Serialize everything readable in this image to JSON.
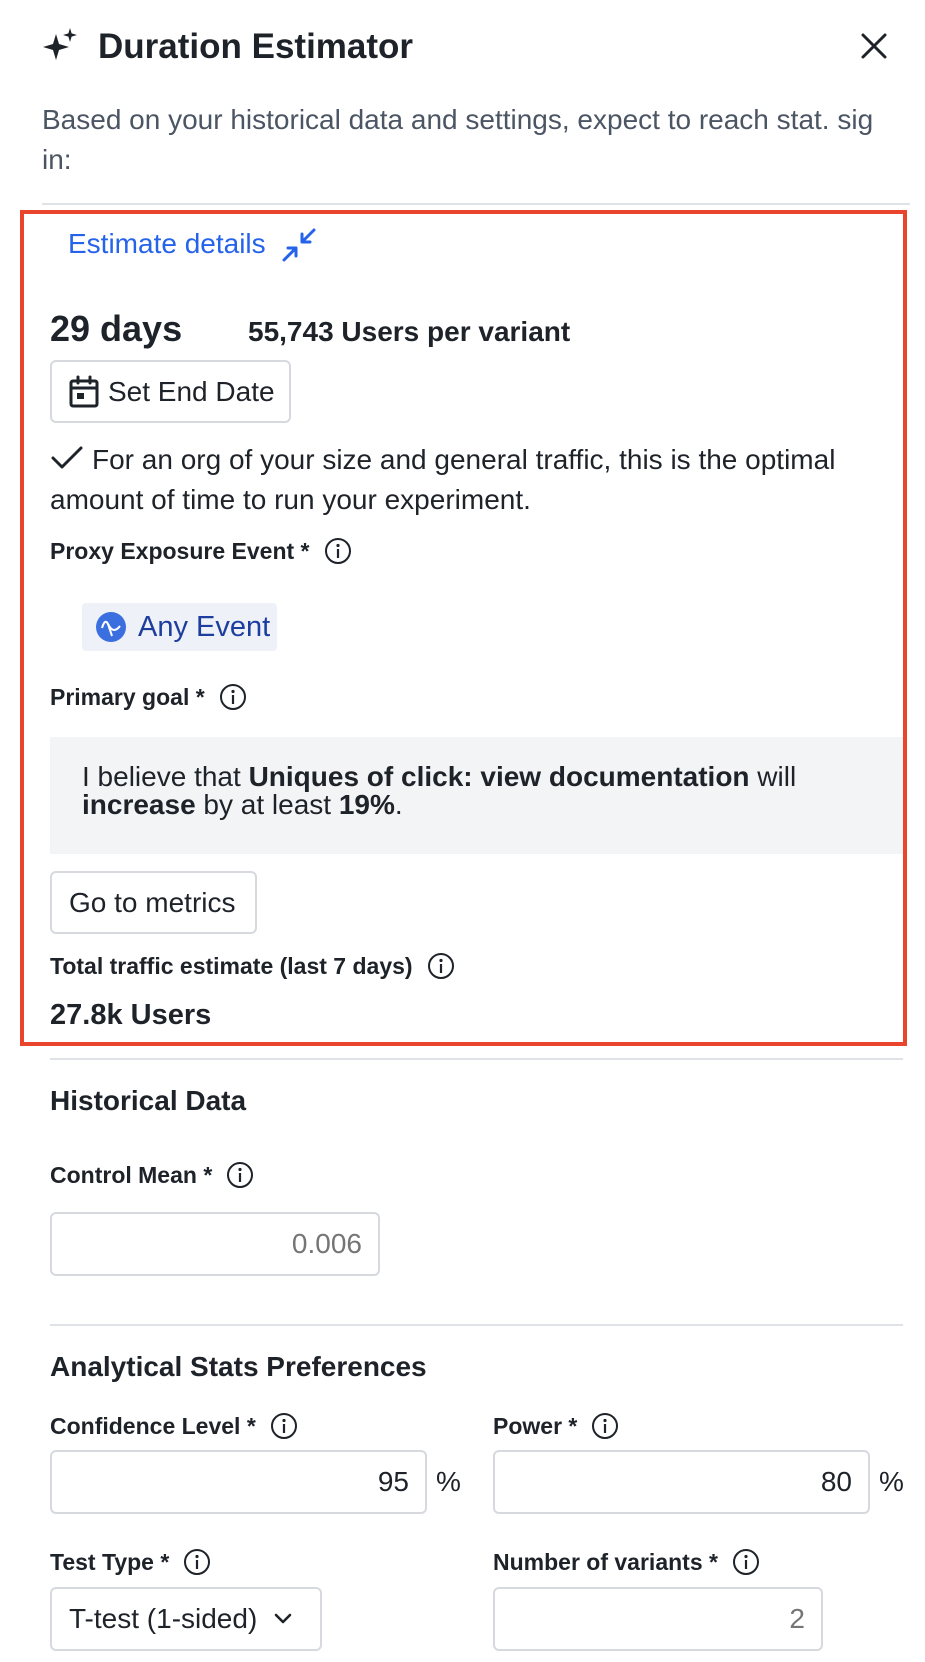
{
  "header": {
    "title": "Duration Estimator",
    "subtitle": "Based on your historical data and settings, expect to reach stat. sig in:",
    "icons": {
      "title_icon": "sparkle-icon",
      "close": "close-icon"
    }
  },
  "estimate": {
    "details_link": "Estimate details",
    "days": "29 days",
    "users_per_variant": "55,743 Users per variant",
    "set_end_date_label": "Set End Date",
    "optimal_message": "For an org of your size and general traffic, this is the optimal amount of time to run your experiment.",
    "proxy_label": "Proxy Exposure Event",
    "proxy_event": "Any Event",
    "primary_goal_label": "Primary goal",
    "goal": {
      "prefix": "I believe that ",
      "metric": "Uniques of click: view documentation",
      "middle": " will ",
      "direction": "increase",
      "by_text": " by at least ",
      "amount": "19%",
      "suffix": "."
    },
    "go_to_metrics_label": "Go to metrics",
    "traffic_label": "Total traffic estimate (last 7 days)",
    "traffic_value": "27.8k Users"
  },
  "historical": {
    "title": "Historical Data",
    "control_mean_label": "Control Mean",
    "control_mean_placeholder": "0.006"
  },
  "stats": {
    "title": "Analytical Stats Preferences",
    "confidence_label": "Confidence Level",
    "confidence_value": "95",
    "power_label": "Power",
    "power_value": "80",
    "percent_symbol": "%",
    "test_type_label": "Test Type",
    "test_type_value": "T-test (1-sided)",
    "variants_label": "Number of variants",
    "variants_placeholder": "2"
  },
  "required_marker": "*",
  "colors": {
    "accent": "#2563eb",
    "highlight_border": "#e8452c",
    "event_chip_bg": "#eef1f8",
    "goal_bg": "#f3f4f6"
  }
}
